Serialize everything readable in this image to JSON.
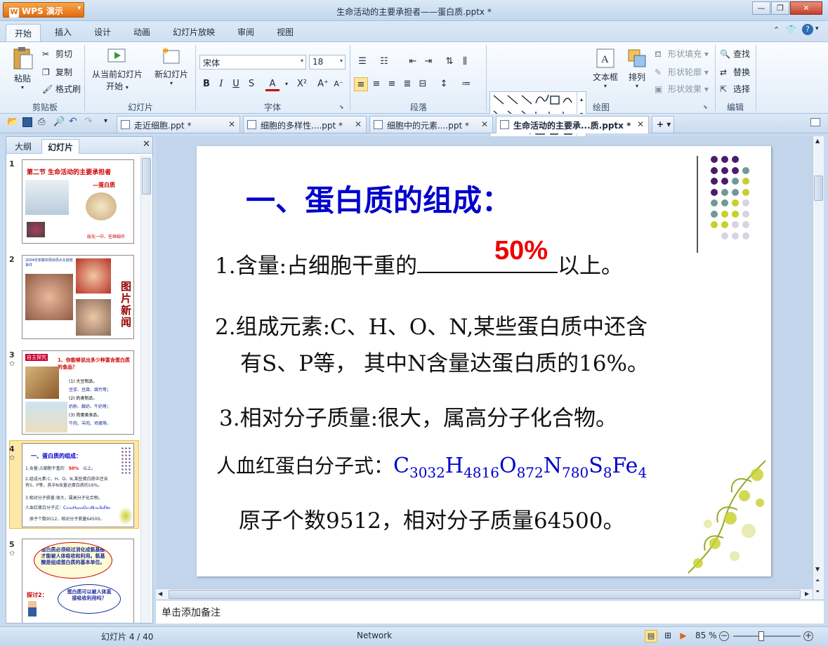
{
  "app": {
    "name": "WPS 演示",
    "window_title": "生命活动的主要承担者——蛋白质.pptx *"
  },
  "menu_tabs": [
    "开始",
    "插入",
    "设计",
    "动画",
    "幻灯片放映",
    "审阅",
    "视图"
  ],
  "ribbon": {
    "clipboard": {
      "paste": "粘贴",
      "cut": "剪切",
      "copy": "复制",
      "format_painter": "格式刷",
      "group": "剪贴板"
    },
    "slides": {
      "from_current_l1": "从当前幻灯片",
      "from_current_l2": "开始",
      "new_slide": "新幻灯片",
      "group": "幻灯片"
    },
    "font": {
      "name": "宋体",
      "size": "18",
      "bold": "B",
      "italic": "I",
      "underline": "U",
      "shadow": "S",
      "group": "字体"
    },
    "paragraph": {
      "group": "段落"
    },
    "drawing": {
      "textbox": "文本框",
      "arrange": "排列",
      "shape_fill": "形状填充",
      "shape_outline": "形状轮廓",
      "shape_effect": "形状效果",
      "group": "绘图"
    },
    "editing": {
      "find": "查找",
      "replace": "替换",
      "select": "选择",
      "group": "编辑"
    }
  },
  "doc_tabs": [
    {
      "label": "走近细胞.ppt *",
      "active": false
    },
    {
      "label": "细胞的多样性....ppt *",
      "active": false
    },
    {
      "label": "细胞中的元素....ppt *",
      "active": false
    },
    {
      "label": "生命活动的主要承...质.pptx *",
      "active": true
    }
  ],
  "left_pane": {
    "tabs": [
      "大纲",
      "幻灯片"
    ],
    "thumbnails": [
      {
        "num": "1",
        "title": "第二节 生命活动的主要承担者",
        "subtitle": "—蛋白质",
        "footer": "绥化一中，任继娟作"
      },
      {
        "num": "2",
        "side": "图片新闻",
        "caption": "2004年安徽阜阳出现大头娃娃事件"
      },
      {
        "num": "3",
        "tag": "自主探究",
        "question": "1、你能够说出多少种富含蛋白质的食品？",
        "l1": "(1) 大豆制品，",
        "l2": "豆浆、豆腐、腐竹等；",
        "l3": "(2) 奶类制品，",
        "l4": "奶粉、酸奶、牛奶等；",
        "l5": "(3) 肉蛋类食品，",
        "l6": "牛肉、羊肉、鸡蛋等。"
      },
      {
        "num": "4",
        "title": "一、蛋白质的组成：",
        "l1": "1.含量:占细胞干重的",
        "pct": "50%",
        "l1b": "以上。",
        "l2": "2.组成元素:C、H、O、N,某些蛋白质中还含",
        "l3": "有S、P等，其中N含量达蛋白质的16%。",
        "l4": "3.相对分子质量:很大，属高分子化合物。",
        "l5": "人血红蛋白分子式：",
        "l6": "原子个数9512，相对分子质量64500。"
      },
      {
        "num": "5",
        "bubble": "蛋白质必须经过消化成氨基酸才能被人体吸收和利用。氨基酸是组成蛋白质的基本单位。",
        "q": "探讨2：",
        "bubble2": "蛋白质可以被人体直接吸收利用吗？"
      }
    ]
  },
  "slide": {
    "title": "一、蛋白质的组成：",
    "line1_a": "1.含量:占细胞干重的",
    "line1_blank": "50%",
    "line1_b": "以上。",
    "line2_a": "2.组成元素:C、H、O、N,某些蛋白质中还含",
    "line2_b": "有S、P等， 其中N含量达蛋白质的16%。",
    "line3": "3.相对分子质量:很大，属高分子化合物。",
    "line4_label": "人血红蛋白分子式：",
    "formula": [
      {
        "sym": "C",
        "sub": "3032"
      },
      {
        "sym": "H",
        "sub": "4816"
      },
      {
        "sym": "O",
        "sub": "872"
      },
      {
        "sym": "N",
        "sub": "780"
      },
      {
        "sym": "S",
        "sub": "8"
      },
      {
        "sym": "Fe",
        "sub": "4"
      }
    ],
    "line5": "原子个数9512，相对分子质量64500。"
  },
  "notes_placeholder": "单击添加备注",
  "status": {
    "slide_counter": "幻灯片 4 / 40",
    "theme": "Network",
    "zoom": "85 %"
  },
  "colors": {
    "accent_blue": "#0000cc",
    "red": "#ee0000",
    "dot_purple": "#4b1b6e",
    "dot_teal": "#6f9a96",
    "dot_lime": "#c8cf2a",
    "dot_lavender": "#d7d2e4"
  }
}
